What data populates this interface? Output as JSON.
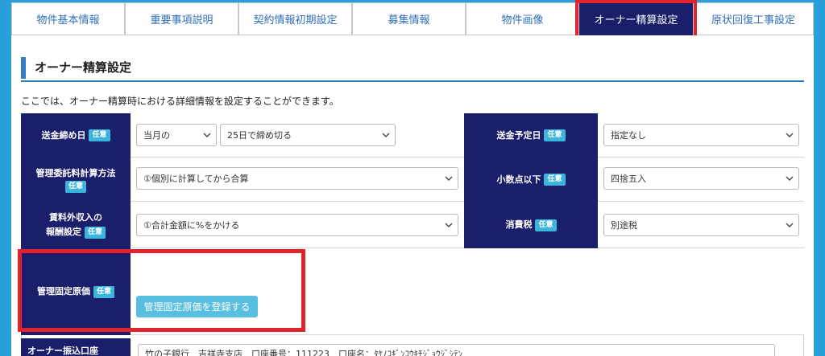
{
  "tabs": [
    {
      "label": "物件基本情報"
    },
    {
      "label": "重要事項説明"
    },
    {
      "label": "契約情報初期設定"
    },
    {
      "label": "募集情報"
    },
    {
      "label": "物件画像"
    },
    {
      "label": "オーナー精算設定"
    },
    {
      "label": "原状回復工事設定"
    }
  ],
  "section": {
    "title": "オーナー精算設定",
    "description": "ここでは、オーナー精算時における詳細情報を設定することができます。"
  },
  "badge_optional": "任意",
  "fields": {
    "closing_day": {
      "label": "送金締め日",
      "month_value": "当月の",
      "day_value": "25日で締め切る"
    },
    "payment_date": {
      "label": "送金予定日",
      "value": "指定なし"
    },
    "mgmt_fee_method": {
      "label": "管理委託料計算方法",
      "value": "①個別に計算してから合算"
    },
    "decimal": {
      "label": "小数点以下",
      "value": "四捨五入"
    },
    "non_rent_income": {
      "label_line1": "賃料外収入の",
      "label_line2": "報酬設定",
      "value": "①合計金額に%をかける"
    },
    "tax": {
      "label": "消費税",
      "value": "別途税"
    },
    "fixed_cost": {
      "label": "管理固定原価",
      "button_label": "管理固定原価を登録する"
    },
    "owner_account": {
      "label": "オーナー振込口座",
      "value": "竹の子銀行　吉祥寺支店　口座番号：111223　口座名：ﾀｹﾉｺｷﾞﾝｺｳｷﾁｼﾞｮｳｼﾞｼﾃﾝ"
    }
  },
  "colors": {
    "background": "#2a9fd8",
    "label_bg": "#1b1e6a",
    "badge": "#3cb5dc",
    "highlight": "#e3232c",
    "button": "#58bfe0"
  }
}
